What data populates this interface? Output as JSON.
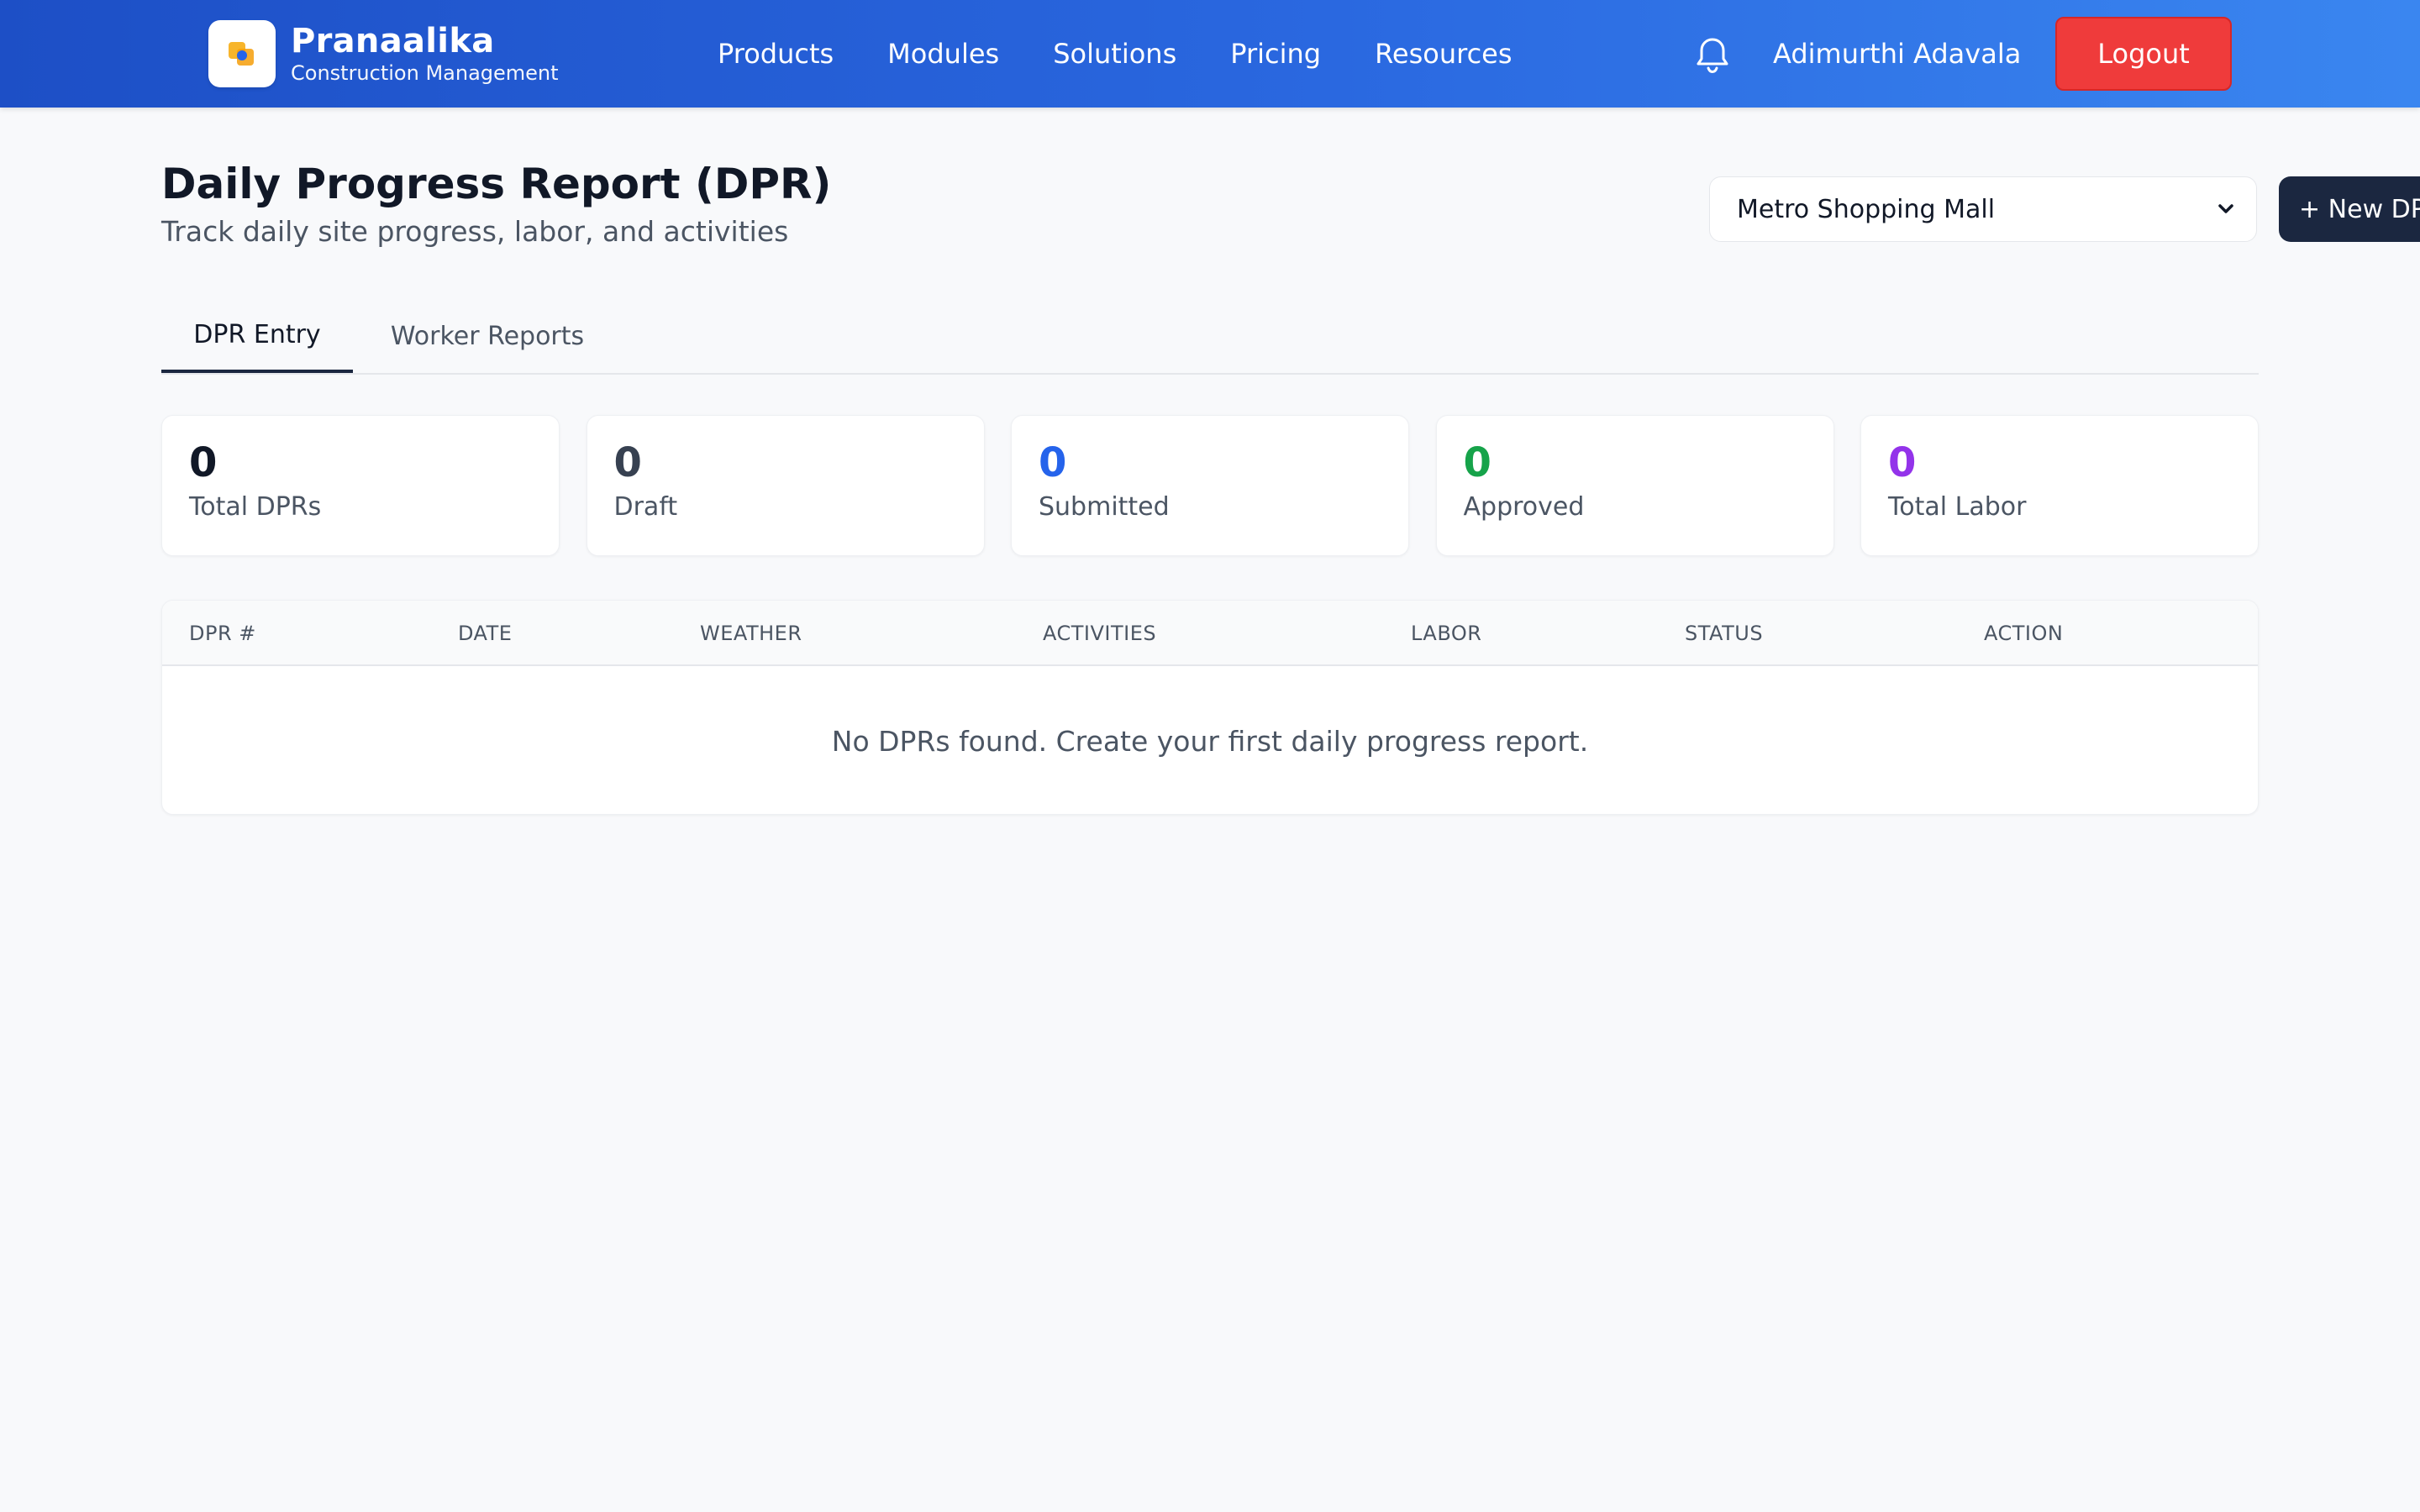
{
  "header": {
    "brand_name": "Pranaalika",
    "brand_subtitle": "Construction Management",
    "nav": [
      "Products",
      "Modules",
      "Solutions",
      "Pricing",
      "Resources"
    ],
    "user_name": "Adimurthi Adavala",
    "logout_label": "Logout",
    "icons": {
      "logo": "pranaalika-logo-icon",
      "notifications": "bell-icon"
    }
  },
  "page": {
    "title": "Daily Progress Report (DPR)",
    "subtitle": "Track daily site progress, labor, and activities",
    "project_select": "Metro Shopping Mall",
    "new_button": "+ New DPR"
  },
  "tabs": [
    {
      "label": "DPR Entry",
      "active": true
    },
    {
      "label": "Worker Reports",
      "active": false
    }
  ],
  "stats": [
    {
      "value": "0",
      "label": "Total DPRs",
      "color": "#111827"
    },
    {
      "value": "0",
      "label": "Draft",
      "color": "#374151"
    },
    {
      "value": "0",
      "label": "Submitted",
      "color": "#2563eb"
    },
    {
      "value": "0",
      "label": "Approved",
      "color": "#16a34a"
    },
    {
      "value": "0",
      "label": "Total Labor",
      "color": "#9333ea"
    }
  ],
  "table": {
    "columns": [
      "DPR #",
      "DATE",
      "WEATHER",
      "ACTIVITIES",
      "LABOR",
      "STATUS",
      "ACTION"
    ],
    "rows": [],
    "empty_message": "No DPRs found. Create your first daily progress report."
  },
  "colors": {
    "header_gradient_start": "#1d4fc6",
    "header_gradient_end": "#3a86f0",
    "logout": "#ef3b3b",
    "primary_dark": "#1b2740",
    "background": "#f8f9fb"
  }
}
